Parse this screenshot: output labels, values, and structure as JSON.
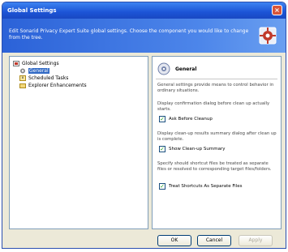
{
  "window": {
    "title": "Global Settings",
    "close_symbol": "×"
  },
  "banner": {
    "text": "Edit Sonarid Privacy Expert Suite global settings. Choose the component you would like to change from the tree."
  },
  "tree": {
    "root": "Global Settings",
    "items": [
      {
        "label": "General",
        "selected": true,
        "icon": "gear-icon"
      },
      {
        "label": "Scheduled Tasks",
        "selected": false,
        "icon": "clock-icon"
      },
      {
        "label": "Explorer Enhancements",
        "selected": false,
        "icon": "folder-icon"
      }
    ]
  },
  "panel": {
    "title": "General",
    "intro": "General settings provide means to control behavior in ordinary situations.",
    "confirm_desc": "Display confirmation dialog before clean up actually starts.",
    "confirm_label": "Ask Before Cleanup",
    "summary_desc": "Display clean-up results summary dialog after clean up is complete.",
    "summary_label": "Show Clean-up Summary",
    "shortcut_desc": "Specify should shortcut files be treated as separate files or resolved to corresponding target files/folders.",
    "shortcut_label": "Treat Shortcuts As Separate Files"
  },
  "buttons": {
    "ok": "OK",
    "cancel": "Cancel",
    "apply": "Apply"
  },
  "colors": {
    "title_bar": "#1c54d6",
    "banner": "#2b62d8",
    "selection": "#316ac5",
    "check": "#21a121"
  }
}
